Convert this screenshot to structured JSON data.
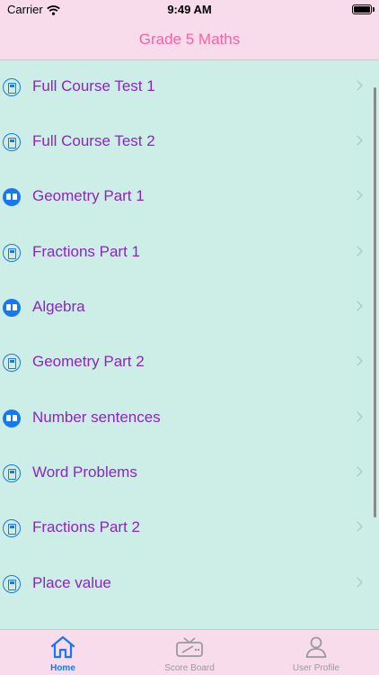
{
  "status_bar": {
    "carrier": "Carrier",
    "time": "9:49 AM"
  },
  "nav": {
    "title": "Grade 5 Maths"
  },
  "items": [
    {
      "label": "Full Course Test 1",
      "icon": "book-outline-icon"
    },
    {
      "label": "Full Course Test 2",
      "icon": "book-outline-icon"
    },
    {
      "label": "Geometry Part 1",
      "icon": "open-book-icon"
    },
    {
      "label": "Fractions Part 1",
      "icon": "book-outline-icon"
    },
    {
      "label": "Algebra",
      "icon": "open-book-icon"
    },
    {
      "label": "Geometry Part 2",
      "icon": "book-outline-icon"
    },
    {
      "label": "Number sentences",
      "icon": "open-book-icon"
    },
    {
      "label": "Word Problems",
      "icon": "book-outline-icon"
    },
    {
      "label": "Fractions Part 2",
      "icon": "book-outline-icon"
    },
    {
      "label": "Place value",
      "icon": "book-outline-icon"
    }
  ],
  "tabs": [
    {
      "label": "Home",
      "icon": "home-icon",
      "active": true
    },
    {
      "label": "Score Board",
      "icon": "scoreboard-icon",
      "active": false
    },
    {
      "label": "User Profile",
      "icon": "user-icon",
      "active": false
    }
  ],
  "colors": {
    "bar_background": "#f8dcec",
    "title": "#f364a4",
    "list_background": "#cdeee6",
    "item_text": "#8a26c6",
    "accent": "#1778f0"
  }
}
